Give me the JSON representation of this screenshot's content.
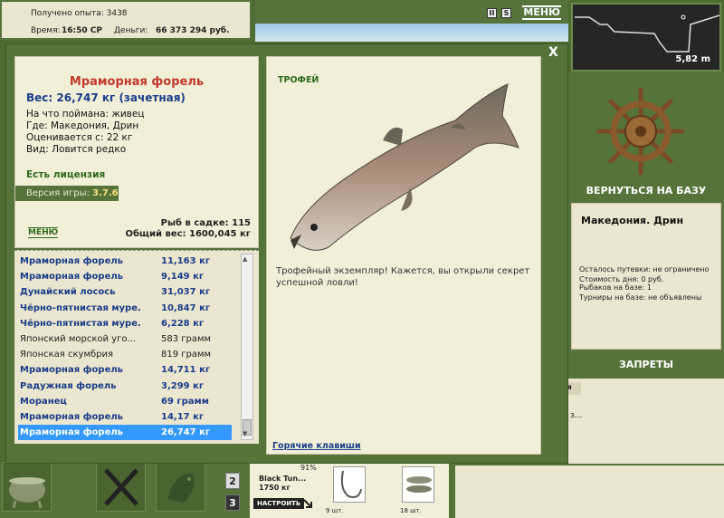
{
  "top_info": {
    "exp_label": "Получено опыта:",
    "exp_value": "3438",
    "time_label": "Время:",
    "time_value": "16:50 СР",
    "money_label": "Деньги:",
    "money_value": "66 373 294 руб."
  },
  "top_bar": {
    "menu_label": "МЕНЮ",
    "btn_pause": "II",
    "btn_s": "S"
  },
  "depth": {
    "value": "5,82 m"
  },
  "window": {
    "close": "X"
  },
  "catch": {
    "name": "Мраморная форель",
    "weight_line": "Вес: 26,747 кг (зачетная)",
    "bait_line": "На что поймана: живец",
    "where_line": "Где: Македония, Дрин",
    "rated_line": "Оценивается с: 22 кг",
    "kind_line": "Вид: Ловится редко",
    "license": "Есть лицензия",
    "version_label": "Версия игры:",
    "version_value": "3.7.6",
    "menu_label": "МЕНЮ",
    "keepnet_count": "Рыб в садке: 115",
    "keepnet_weight": "Общий вес: 1600,045 кг"
  },
  "fish_list": [
    {
      "name": "Мраморная форель",
      "weight": "11,163 кг",
      "bold": true,
      "selected": false
    },
    {
      "name": "Мраморная форель",
      "weight": "9,149 кг",
      "bold": true,
      "selected": false
    },
    {
      "name": "Дунайский лосось",
      "weight": "31,037 кг",
      "bold": true,
      "selected": false
    },
    {
      "name": "Чёрно-пятнистая муре...",
      "weight": "10,847 кг",
      "bold": true,
      "selected": false
    },
    {
      "name": "Чёрно-пятнистая муре...",
      "weight": "6,228 кг",
      "bold": true,
      "selected": false
    },
    {
      "name": "Японский морской уго...",
      "weight": "583 грамм",
      "bold": false,
      "selected": false
    },
    {
      "name": "Японская скумбрия",
      "weight": "819 грамм",
      "bold": false,
      "selected": false
    },
    {
      "name": "Мраморная форель",
      "weight": "14,711 кг",
      "bold": true,
      "selected": false
    },
    {
      "name": "Радужная форель",
      "weight": "3,299 кг",
      "bold": true,
      "selected": false
    },
    {
      "name": "Моранец",
      "weight": "69 грамм",
      "bold": true,
      "selected": false
    },
    {
      "name": "Мраморная форель",
      "weight": "14,17 кг",
      "bold": true,
      "selected": false
    },
    {
      "name": "Мраморная форель",
      "weight": "26,747 кг",
      "bold": true,
      "selected": true
    }
  ],
  "trophy": {
    "title": "ТРОФЕЙ",
    "text": "Трофейный экземпляр! Кажется, вы открыли секрет успешной ловли!",
    "hotkeys": "Горячие клавиши"
  },
  "base": {
    "return_label": "ВЕРНУТЬСЯ НА БАЗУ",
    "title": "Македония. Дрин",
    "lines": [
      "Осталось путевки: не ограничено",
      "Стоимость дня: 0 руб.",
      "Рыбаков на базе: 1",
      "Турниры на базе: не объявлены"
    ],
    "bans_label": "ЗАПРЕТЫ",
    "tab_label": "ия",
    "low_text": "з..."
  },
  "bottom": {
    "btn2": "2",
    "btn3": "3",
    "rod_name": "Black Tun...",
    "rod_weight": "1750 кг",
    "rod_pct": "91%",
    "setup_label": "НАСТРОИТЬ",
    "bait1_count": "9 шт.",
    "bait2_count": "18 шт."
  },
  "colors": {
    "frame_green": "#56733a",
    "panel_cream": "#f2efd9",
    "title_red": "#c0392b",
    "value_blue": "#1a3d8a",
    "selected_blue": "#3399ff"
  }
}
